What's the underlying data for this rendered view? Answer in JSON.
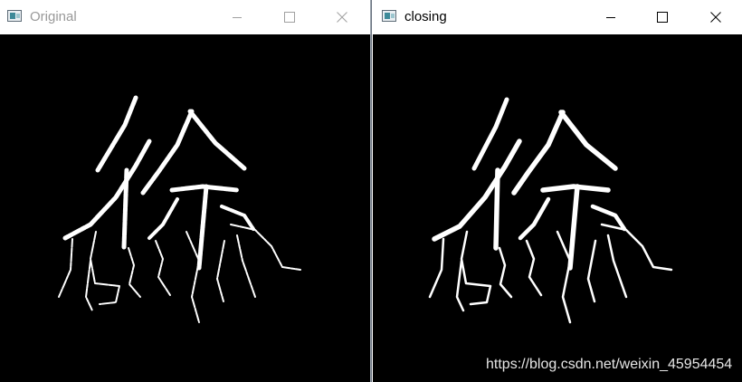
{
  "windows": {
    "original": {
      "title": "Original"
    },
    "closing": {
      "title": "closing"
    }
  },
  "watermark": "https://blog.csdn.net/weixin_45954454",
  "colors": {
    "title_active": "#000000",
    "title_inactive": "#999999",
    "canvas": "#000000",
    "glyph": "#ffffff"
  },
  "icons": [
    "app-icon",
    "minimize-icon",
    "maximize-icon",
    "close-icon"
  ]
}
